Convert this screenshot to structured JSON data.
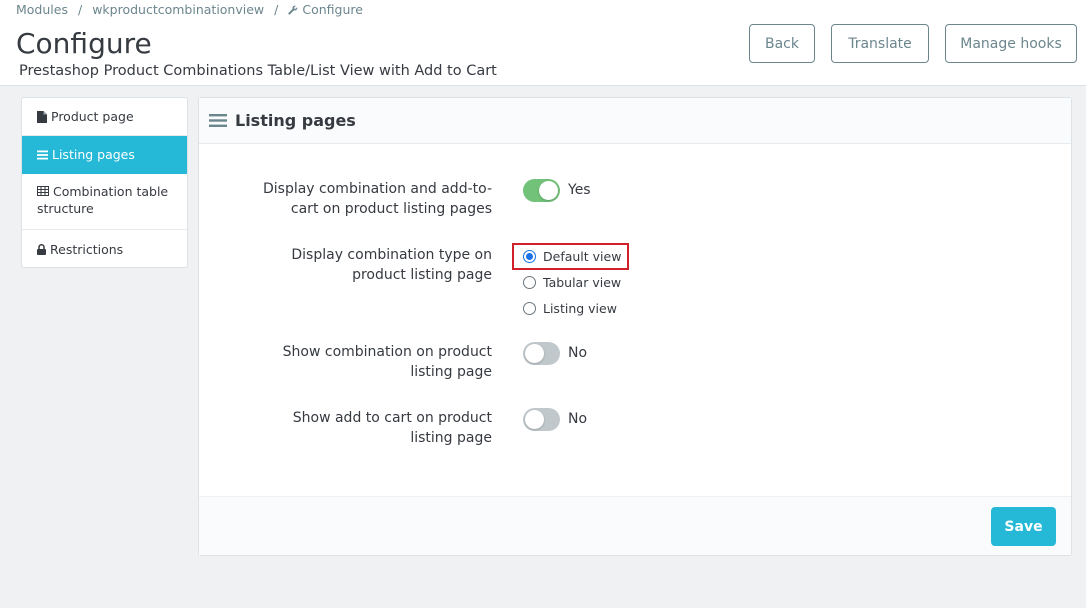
{
  "breadcrumb": {
    "items": [
      "Modules",
      "wkproductcombinationview",
      "Configure"
    ],
    "separator": "/"
  },
  "header": {
    "title": "Configure",
    "subtitle": "Prestashop Product Combinations Table/List View with Add to Cart",
    "buttons": {
      "back": "Back",
      "translate": "Translate",
      "manage_hooks": "Manage hooks"
    }
  },
  "sidebar": {
    "items": [
      {
        "label": "Product page",
        "icon": "file-icon",
        "active": false
      },
      {
        "label": "Listing pages",
        "icon": "list-icon",
        "active": true
      },
      {
        "label": "Combination table structure",
        "icon": "table-icon",
        "active": false
      },
      {
        "label": "Restrictions",
        "icon": "lock-icon",
        "active": false
      }
    ]
  },
  "panel": {
    "title": "Listing pages",
    "title_icon": "bars-icon",
    "fields": {
      "display_combination": {
        "label": "Display combination and add-to-cart on product listing pages",
        "value": true,
        "value_text": "Yes"
      },
      "combination_type": {
        "label": "Display combination type on product listing page",
        "options": [
          "Default view",
          "Tabular view",
          "Listing view"
        ],
        "selected": "Default view"
      },
      "show_combination": {
        "label": "Show combination on product listing page",
        "value": false,
        "value_text": "No"
      },
      "show_add_to_cart": {
        "label": "Show add to cart on product listing page",
        "value": false,
        "value_text": "No"
      }
    },
    "save_label": "Save"
  },
  "colors": {
    "primary": "#25b9d7",
    "switch_on": "#72c279",
    "switch_off": "#c0c8cc",
    "radio_checked": "#1d72e8",
    "highlight": "#d0202a"
  }
}
